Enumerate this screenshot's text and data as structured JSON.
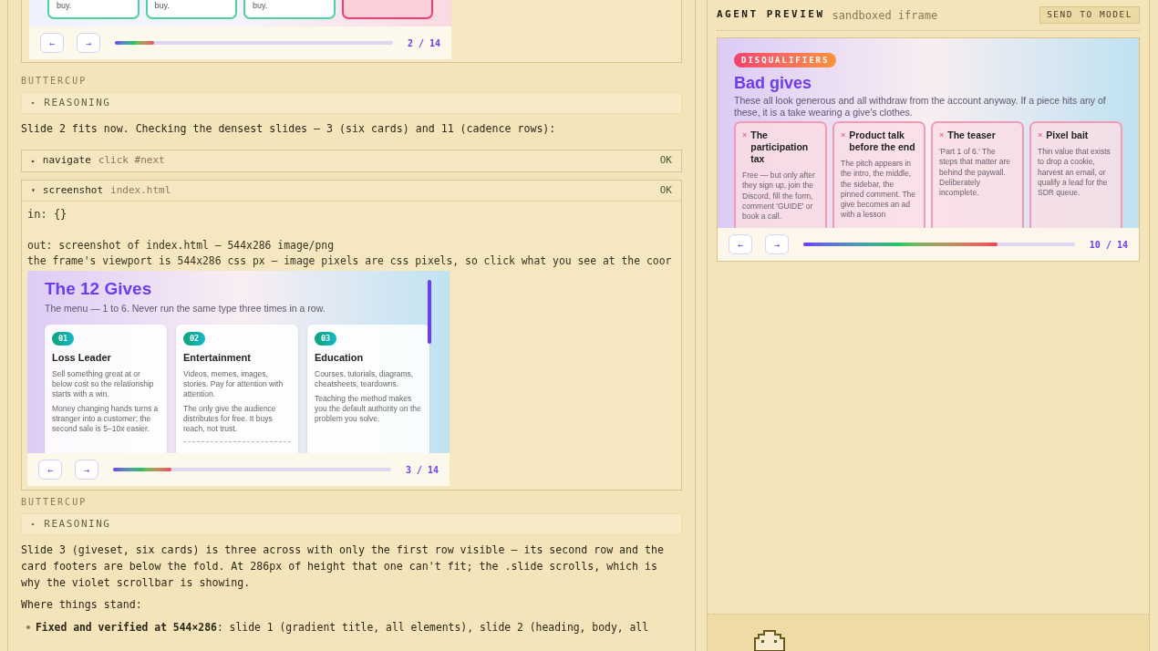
{
  "transcript": [
    {
      "kind": "frame",
      "slide": {
        "kind": "cards-tail",
        "cards": [
          {
            "text": "buy.",
            "color": "#4ed19a"
          },
          {
            "text": "buy.",
            "color": "#4ed19a"
          },
          {
            "text": "buy.",
            "color": "#4ed19a"
          },
          {
            "color": "#f43f6e"
          }
        ]
      },
      "nav": {
        "prev": "←",
        "next": "→",
        "level": 0.14,
        "counter": "2 / 14"
      }
    },
    {
      "kind": "speaker",
      "text": "BUTTERCUP"
    },
    {
      "kind": "reasoning",
      "marker": "▸",
      "label": "REASONING"
    },
    {
      "kind": "message",
      "paragraphs": [
        "Slide 2 fits now. Checking the densest slides — 3 (six cards) and 11 (cadence rows):"
      ]
    },
    {
      "kind": "tool",
      "marker": "▸",
      "name": "navigate",
      "arg": "click #next",
      "status": "OK",
      "expanded": false
    },
    {
      "kind": "tool",
      "marker": "▾",
      "name": "screenshot",
      "arg": "index.html",
      "status": "OK",
      "expanded": true,
      "input": "in: {}",
      "output": [
        "out: screenshot of index.html — 544x286 image/png",
        "the frame's viewport is 544x286 css px — image pixels are css pixels, so click what you see at the coor"
      ],
      "slide": {
        "kind": "giveset",
        "title": "The 12 Gives",
        "subtitle": "The menu — 1 to 6. Never run the same type three times in a row.",
        "cards": [
          {
            "badge": "01",
            "title": "Loss Leader",
            "body": [
              "Sell something great at or below cost so the relationship starts with a win.",
              "Money changing hands turns a stranger into a customer; the second sale is 5–10x easier."
            ],
            "divider": false
          },
          {
            "badge": "02",
            "title": "Entertainment",
            "body": [
              "Videos, memes, images, stories. Pay for attention with attention.",
              "The only give the audience distributes for free. It buys reach, not trust."
            ],
            "divider": true
          },
          {
            "badge": "03",
            "title": "Education",
            "body": [
              "Courses, tutorials, diagrams, cheatsheets, teardowns.",
              "Teaching the method makes you the default authority on the problem you solve."
            ],
            "divider": false
          }
        ]
      },
      "nav": {
        "prev": "←",
        "next": "→",
        "level": 0.21,
        "counter": "3 / 14"
      }
    },
    {
      "kind": "speaker",
      "text": "BUTTERCUP"
    },
    {
      "kind": "reasoning",
      "marker": "▸",
      "label": "REASONING"
    },
    {
      "kind": "message",
      "paragraphs": [
        "Slide 3 (giveset, six cards) is three across with only the first row visible — its second row and the card footers are below the fold. At 286px of height that one can't fit; the .slide scrolls, which is why the violet scrollbar is showing.",
        "Where things stand:"
      ]
    },
    {
      "kind": "bullet",
      "text": "**Fixed and verified at 544×286**: slide 1 (gradient title, all elements), slide 2 (heading, body, all"
    }
  ],
  "preview": {
    "label": "AGENT PREVIEW",
    "sublabel": "sandboxed iframe",
    "button": "SEND TO MODEL",
    "slide": {
      "badge": "DISQUALIFIERS",
      "title": "Bad gives",
      "subtitle": "These all look generous and all withdraw from the account anyway. If a piece hits any of these, it is a take wearing a give's clothes.",
      "cards": [
        {
          "mark": "×",
          "title": "The participation tax",
          "body": "Free — but only after they sign up, join the Discord, fill the form, comment 'GUIDE' or book a call."
        },
        {
          "mark": "×",
          "title": "Product talk before the end",
          "body": "The pitch appears in the intro, the middle, the sidebar, the pinned comment. The give becomes an ad with a lesson"
        },
        {
          "mark": "×",
          "title": "The teaser",
          "body": "'Part 1 of 6.' The steps that matter are behind the paywall. Deliberately incomplete."
        },
        {
          "mark": "×",
          "title": "Pixel bait",
          "body": "Thin value that exists to drop a cookie, harvest an email, or qualify a lead for the SDR queue."
        }
      ]
    },
    "nav": {
      "prev": "←",
      "next": "→",
      "level": 0.715,
      "counter": "10 / 14"
    }
  }
}
